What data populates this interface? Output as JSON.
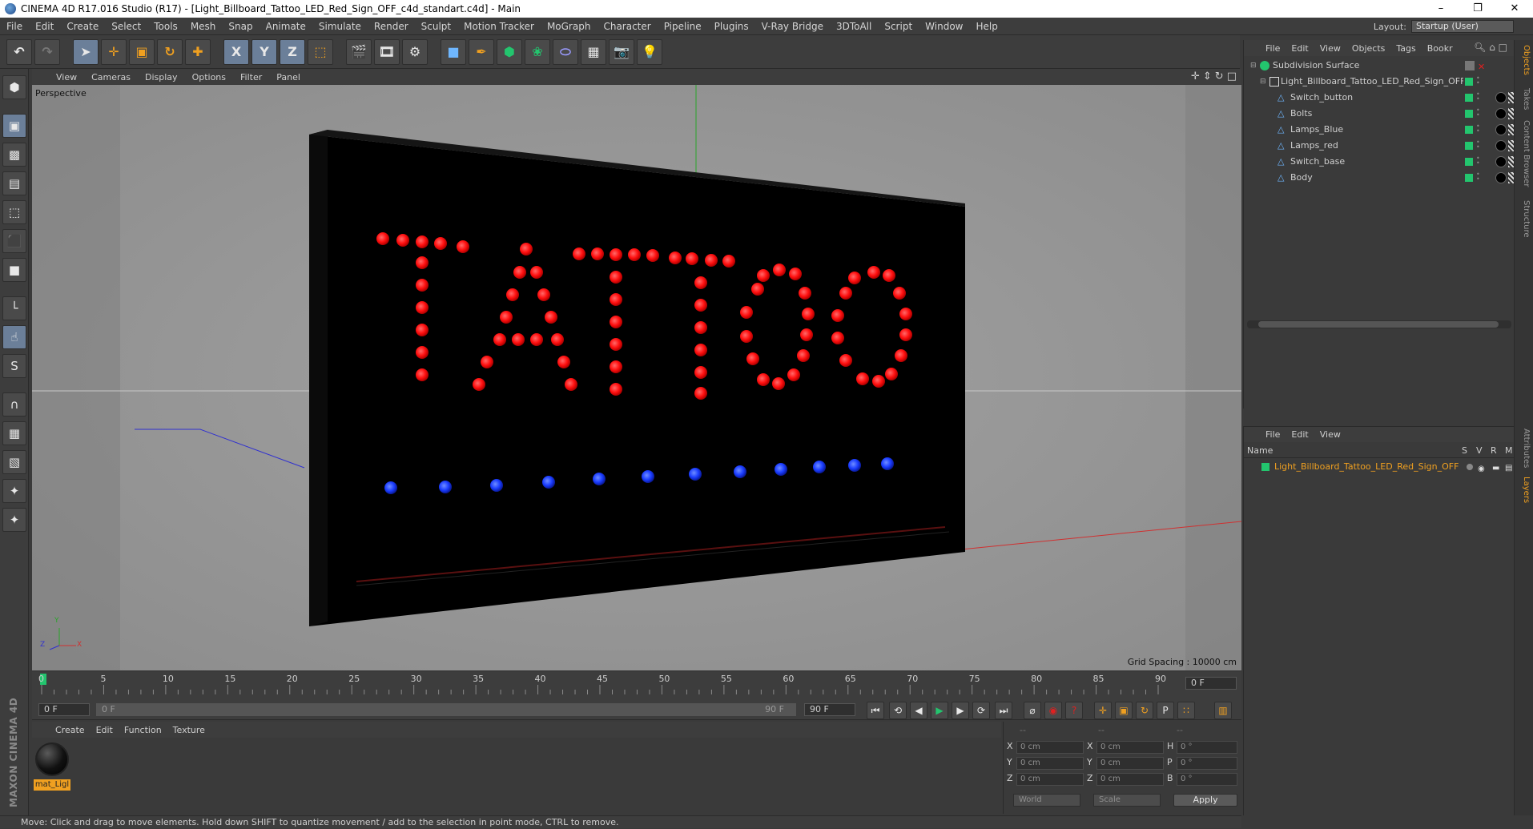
{
  "window": {
    "title": "CINEMA 4D R17.016 Studio (R17) - [Light_Billboard_Tattoo_LED_Red_Sign_OFF_c4d_standart.c4d] - Main",
    "controls": [
      "–",
      "❐",
      "✕"
    ]
  },
  "menubar": {
    "items": [
      "File",
      "Edit",
      "Create",
      "Select",
      "Tools",
      "Mesh",
      "Snap",
      "Animate",
      "Simulate",
      "Render",
      "Sculpt",
      "Motion Tracker",
      "MoGraph",
      "Character",
      "Pipeline",
      "Plugins",
      "V-Ray Bridge",
      "3DToAll",
      "Script",
      "Window",
      "Help"
    ],
    "layout_label": "Layout:",
    "layout_value": "Startup (User)"
  },
  "toolbar": {
    "x_axis": "X",
    "y_axis": "Y",
    "z_axis": "Z",
    "icons": [
      "undo-icon",
      "redo-icon",
      "select-icon",
      "move-icon",
      "scale-icon",
      "rotate-icon",
      "live-select-icon",
      "x-lock-icon",
      "y-lock-icon",
      "z-lock-icon",
      "coordinate-system-icon",
      "render-view-icon",
      "render-picture-viewer-icon",
      "edit-render-settings-icon",
      "cube-icon",
      "pen-icon",
      "subdivision-icon",
      "array-icon",
      "deformer-icon",
      "floor-icon",
      "camera-icon",
      "light-icon"
    ]
  },
  "viewport": {
    "menu": [
      "View",
      "Cameras",
      "Display",
      "Options",
      "Filter",
      "Panel"
    ],
    "label": "Perspective",
    "grid_spacing": "Grid Spacing : 10000 cm",
    "axis_labels": {
      "y": "Y",
      "z": "Z",
      "x": "X"
    },
    "sign_text": "TATTOO"
  },
  "timeline": {
    "ticks": [
      "0",
      "5",
      "10",
      "15",
      "20",
      "25",
      "30",
      "35",
      "40",
      "45",
      "50",
      "55",
      "60",
      "65",
      "70",
      "75",
      "80",
      "85",
      "90"
    ],
    "current_frame": "0 F"
  },
  "transport": {
    "start_field": "0 F",
    "range_start": "0 F",
    "range_end": "90 F",
    "end_field": "90 F"
  },
  "materials": {
    "menu": [
      "Create",
      "Edit",
      "Function",
      "Texture"
    ],
    "items": [
      {
        "name": "mat_Ligl"
      }
    ]
  },
  "coordinates": {
    "header": [
      "--",
      "--",
      "--"
    ],
    "rows": [
      {
        "a": "X",
        "av": "0 cm",
        "b": "X",
        "bv": "0 cm",
        "c": "H",
        "cv": "0 °"
      },
      {
        "a": "Y",
        "av": "0 cm",
        "b": "Y",
        "bv": "0 cm",
        "c": "P",
        "cv": "0 °"
      },
      {
        "a": "Z",
        "av": "0 cm",
        "b": "Z",
        "bv": "0 cm",
        "c": "B",
        "cv": "0 °"
      }
    ],
    "mode": "World",
    "scale": "Scale",
    "apply": "Apply"
  },
  "objects": {
    "menu": [
      "File",
      "Edit",
      "View",
      "Objects",
      "Tags",
      "Bookr"
    ],
    "tree": [
      {
        "name": "Subdivision Surface",
        "level": 0
      },
      {
        "name": "Light_Billboard_Tattoo_LED_Red_Sign_OFF",
        "level": 1
      },
      {
        "name": "Switch_button",
        "level": 2
      },
      {
        "name": "Bolts",
        "level": 2
      },
      {
        "name": "Lamps_Blue",
        "level": 2
      },
      {
        "name": "Lamps_red",
        "level": 2
      },
      {
        "name": "Switch_base",
        "level": 2
      },
      {
        "name": "Body",
        "level": 2
      }
    ]
  },
  "layers": {
    "menu": [
      "File",
      "Edit",
      "View"
    ],
    "columns": [
      "Name",
      "S",
      "V",
      "R",
      "M"
    ],
    "rows": [
      {
        "name": "Light_Billboard_Tattoo_LED_Red_Sign_OFF"
      }
    ]
  },
  "side_tabs": [
    "Objects",
    "Takes",
    "Content Browser",
    "Structure",
    "Attributes",
    "Layers"
  ],
  "status": "Move: Click and drag to move elements. Hold down SHIFT to quantize movement / add to the selection in point mode, CTRL to remove.",
  "brand": "MAXON CINEMA 4D",
  "colors": {
    "led_red": "#ff1010",
    "led_blue": "#1a3cff",
    "accent_orange": "#f0a020",
    "tag_green": "#23c56e"
  }
}
